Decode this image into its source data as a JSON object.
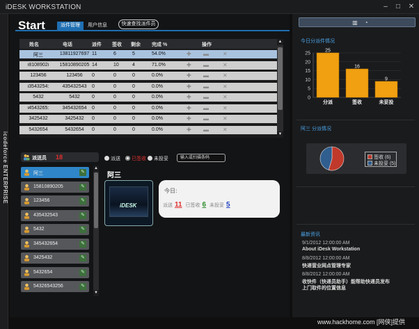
{
  "app": {
    "title": "iDESK WORKSTATION",
    "vertical_label": "icodeforce ENTERPRISE"
  },
  "window_controls": {
    "minimize": "–",
    "maximize": "□",
    "close": "✕"
  },
  "header": {
    "title": "Start",
    "tabs": [
      {
        "label": "派件管理",
        "active": true
      },
      {
        "label": "用户信息",
        "active": false
      }
    ],
    "quick_find_label": "快速查找派件员"
  },
  "table": {
    "columns": [
      "姓名",
      "电话",
      "派件",
      "签收",
      "剩余",
      "完成 %",
      "操作"
    ],
    "rows": [
      {
        "name": "阿三",
        "phone": "13811927697",
        "dispatched": "11",
        "signed": "6",
        "remaining": "5",
        "rate": "54.0%",
        "selected": true
      },
      {
        "name": "i8108902i",
        "phone": "15810890205",
        "dispatched": "14",
        "signed": "10",
        "remaining": "4",
        "rate": "71.0%",
        "selected": false
      },
      {
        "name": "123456",
        "phone": "123456",
        "dispatched": "0",
        "signed": "0",
        "remaining": "0",
        "rate": "0.0%",
        "selected": false
      },
      {
        "name": "i3543254:",
        "phone": "435432543",
        "dispatched": "0",
        "signed": "0",
        "remaining": "0",
        "rate": "0.0%",
        "selected": false
      },
      {
        "name": "5432",
        "phone": "5432",
        "dispatched": "0",
        "signed": "0",
        "remaining": "0",
        "rate": "0.0%",
        "selected": false
      },
      {
        "name": "i4543265:",
        "phone": "345432654",
        "dispatched": "0",
        "signed": "0",
        "remaining": "0",
        "rate": "0.0%",
        "selected": false
      },
      {
        "name": "3425432",
        "phone": "3425432",
        "dispatched": "0",
        "signed": "0",
        "remaining": "0",
        "rate": "0.0%",
        "selected": false
      },
      {
        "name": "5432654",
        "phone": "5432654",
        "dispatched": "0",
        "signed": "0",
        "remaining": "0",
        "rate": "0.0%",
        "selected": false
      }
    ]
  },
  "couriers": {
    "title": "派送员",
    "count": "18",
    "items": [
      {
        "name": "阿三",
        "selected": true
      },
      {
        "name": "15810890205",
        "selected": false
      },
      {
        "name": "123456",
        "selected": false
      },
      {
        "name": "435432543",
        "selected": false
      },
      {
        "name": "5432",
        "selected": false
      },
      {
        "name": "345432654",
        "selected": false
      },
      {
        "name": "3425432",
        "selected": false
      },
      {
        "name": "5432654",
        "selected": false
      },
      {
        "name": "54326543256",
        "selected": false
      }
    ]
  },
  "filters": {
    "options": [
      {
        "label": "派送",
        "checked": false
      },
      {
        "label": "已签收",
        "checked": true
      },
      {
        "label": "未投妥",
        "checked": false
      }
    ],
    "scan_placeholder": "输入或扫描条码"
  },
  "detail": {
    "name": "阿三",
    "photo_text": "iDESK",
    "today_label": "今日:",
    "dispatched_label": "派送",
    "dispatched": "11",
    "signed_label": "已签收",
    "signed": "6",
    "undelivered_label": "未投妥",
    "undelivered": "5"
  },
  "right": {
    "dispatch_title": "今日分派件情况",
    "pie_title": "阿三 分派情况",
    "pie_legend": [
      {
        "label": "签收 (6)",
        "color": "#c0392b"
      },
      {
        "label": "未投妥 (5)",
        "color": "#2f5e8f"
      }
    ],
    "news_title": "最新资讯",
    "news": [
      {
        "date": "9/1/2012 12:00:00 AM",
        "text": "About iDesk Workstation"
      },
      {
        "date": "8/8/2012 12:00:00 AM",
        "text": "快递营业网点管理专家"
      },
      {
        "date": "8/8/2012 12:00:00 AM",
        "text": "收快件（快递员助手）能帮助快递员发布",
        "text2": "上门取件的位置信息"
      }
    ]
  },
  "chart_data": {
    "type": "bar",
    "categories": [
      "分派",
      "签收",
      "未妥投"
    ],
    "values": [
      25,
      16,
      9
    ],
    "ylim": [
      0,
      25
    ],
    "yticks": [
      0,
      5,
      10,
      15,
      20,
      25
    ],
    "bar_color": "#f0a010"
  },
  "pie_data": {
    "type": "pie",
    "values": [
      6,
      5
    ],
    "colors": [
      "#c0392b",
      "#2f5e8f"
    ]
  },
  "watermark": "www.hackhome.com [网侠]提供"
}
